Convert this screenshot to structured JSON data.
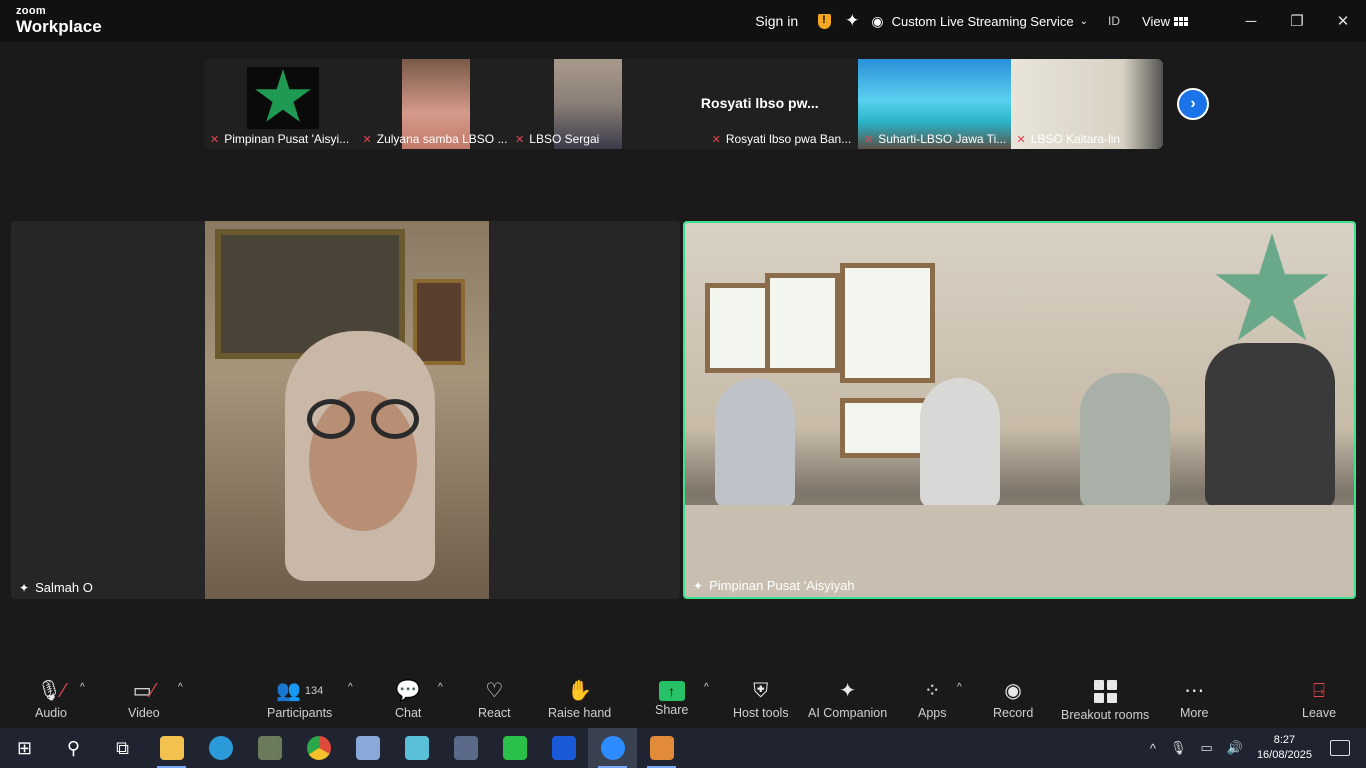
{
  "app": {
    "logo_top": "zoom",
    "logo_bottom": "Workplace",
    "sign_in": "Sign in",
    "streaming_label": "Custom Live Streaming Service",
    "id_label": "ID",
    "view_label": "View",
    "accent_color": "#3ee28d"
  },
  "strip": {
    "participants": [
      {
        "name": "Pimpinan Pusat 'Aisyi...",
        "icon": "muted-mic-icon"
      },
      {
        "name": "Zulyana samba LBSO ...",
        "icon": "muted-mic-icon"
      },
      {
        "name": "LBSO Sergai",
        "icon": "muted-mic-icon"
      },
      {
        "name": "Rosyati lbso pwa Ban...",
        "display": "Rosyati lbso pw...",
        "icon": "muted-mic-icon"
      },
      {
        "name": "Suharti-LBSO Jawa Ti...",
        "icon": "muted-mic-icon"
      },
      {
        "name": "LBSO Kaltara-lin",
        "icon": "muted-mic-icon"
      }
    ]
  },
  "main": {
    "left_name": "Salmah O",
    "right_name": "Pimpinan Pusat 'Aisyiyah"
  },
  "toolbar": {
    "audio": "Audio",
    "video": "Video",
    "participants": "Participants",
    "participant_count": "134",
    "chat": "Chat",
    "react": "React",
    "raise_hand": "Raise hand",
    "share": "Share",
    "host_tools": "Host tools",
    "ai_companion": "AI Companion",
    "apps": "Apps",
    "record": "Record",
    "breakout_rooms": "Breakout rooms",
    "more": "More",
    "leave": "Leave"
  },
  "taskbar": {
    "time": "8:27",
    "date": "16/08/2025"
  }
}
